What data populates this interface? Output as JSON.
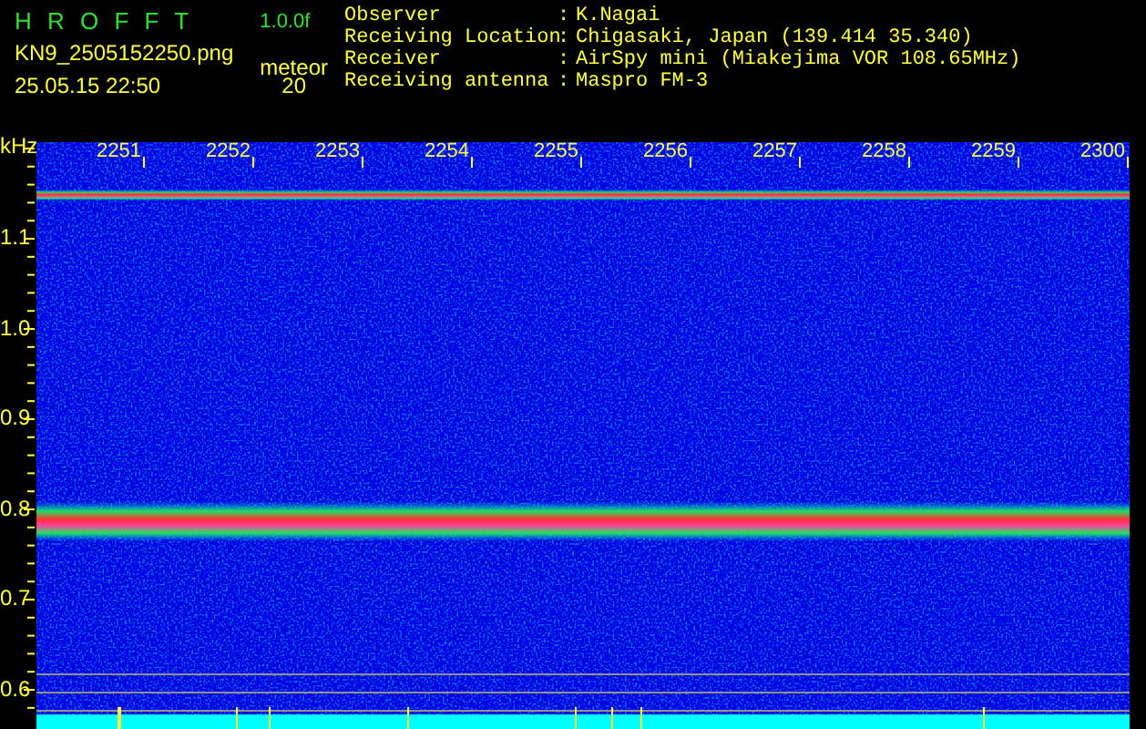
{
  "header": {
    "app_title": "H R O F F T",
    "version": "1.0.0f",
    "file_name": "KN9_2505152250.png",
    "timestamp": "25.05.15 22:50",
    "meteor_label": "meteor",
    "meteor_count": "20"
  },
  "info": [
    {
      "label": "Observer",
      "separator": ":",
      "value": "K.Nagai"
    },
    {
      "label": "Receiving Location",
      "separator": ":",
      "value": "Chigasaki, Japan (139.414 35.340)"
    },
    {
      "label": "Receiver",
      "separator": ":",
      "value": "AirSpy mini (Miakejima VOR 108.65MHz)"
    },
    {
      "label": "Receiving antenna",
      "separator": ":",
      "value": "Maspro FM-3"
    }
  ],
  "spectrogram": {
    "unit": "kHz",
    "time_labels": [
      "2251",
      "2252",
      "2253",
      "2254",
      "2255",
      "2256",
      "2257",
      "2258",
      "2259",
      "2300"
    ],
    "freq_labels": [
      "1.1",
      "1.0",
      "0.9",
      "0.8",
      "0.7",
      "0.6"
    ]
  }
}
